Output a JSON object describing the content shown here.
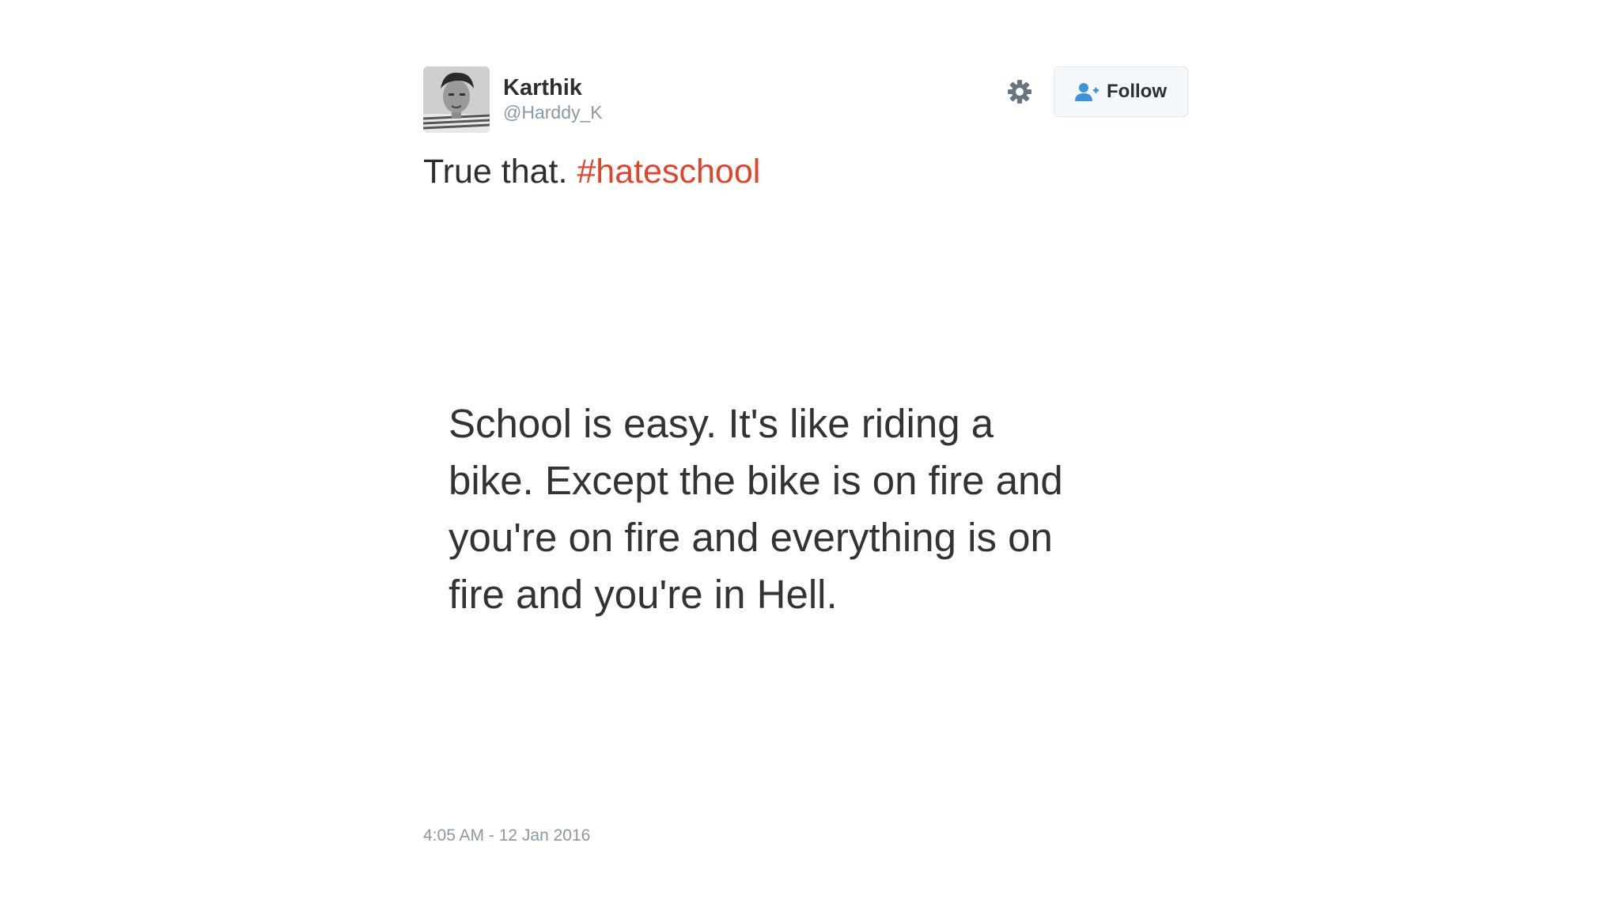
{
  "author": {
    "display_name": "Karthik",
    "handle": "@Harddy_K",
    "avatar": "profile-photo"
  },
  "actions": {
    "settings_icon": "gear-icon",
    "follow_icon": "add-person-icon",
    "follow_label": "Follow",
    "follow_icon_color": "#3b94d9"
  },
  "tweet": {
    "text": "True that. ",
    "hashtag": "#hateschool",
    "hashtag_color": "#e0442a"
  },
  "image_text": "School is easy. It's like riding a\nbike. Except the bike is on fire and\nyou're on fire and everything is on\nfire and you're in Hell.",
  "timestamp": "4:05 AM - 12 Jan 2016"
}
